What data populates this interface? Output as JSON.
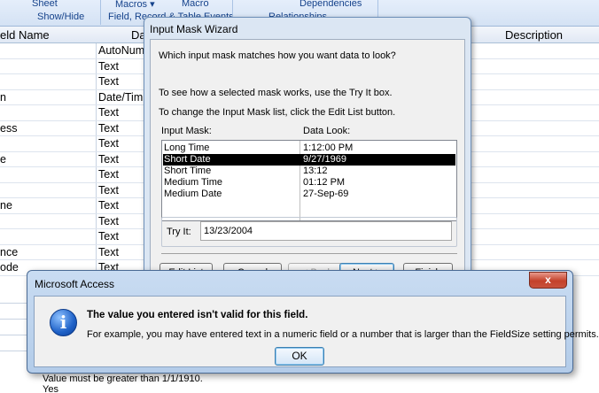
{
  "ribbon": {
    "items": [
      "Sheet",
      "Macros ▾",
      "Macro",
      "Dependencies",
      "Show/Hide",
      "Field, Record & Table Events",
      "Relationships"
    ]
  },
  "grid": {
    "headers": [
      "eld Name",
      "Da",
      "Description"
    ],
    "rows": [
      {
        "name": "",
        "type": "AutoNum"
      },
      {
        "name": "",
        "type": "Text"
      },
      {
        "name": "",
        "type": "Text"
      },
      {
        "name": "n",
        "type": "Date/Tim"
      },
      {
        "name": "",
        "type": "Text"
      },
      {
        "name": "ess",
        "type": "Text"
      },
      {
        "name": "",
        "type": "Text"
      },
      {
        "name": "e",
        "type": "Text"
      },
      {
        "name": "",
        "type": "Text"
      },
      {
        "name": "",
        "type": "Text"
      },
      {
        "name": "ne",
        "type": "Text"
      },
      {
        "name": "",
        "type": "Text"
      },
      {
        "name": "",
        "type": "Text"
      },
      {
        "name": "nce",
        "type": "Text"
      },
      {
        "name": "ode",
        "type": "Text"
      }
    ]
  },
  "lower": {
    "validation_text": "Value must be greater than 1/1/1910.",
    "required": "Yes"
  },
  "wizard": {
    "title": "Input Mask Wizard",
    "question": "Which input mask matches how you want data to look?",
    "try_hint": "To see how a selected mask works, use the Try It box.",
    "edit_hint": "To change the Input Mask list, click the Edit List button.",
    "col_mask": "Input Mask:",
    "col_look": "Data Look:",
    "masks": [
      {
        "mask": "Long Time",
        "look": "1:12:00 PM"
      },
      {
        "mask": "Short Date",
        "look": "9/27/1969"
      },
      {
        "mask": "Short Time",
        "look": "13:12"
      },
      {
        "mask": "Medium Time",
        "look": "01:12 PM"
      },
      {
        "mask": "Medium Date",
        "look": "27-Sep-69"
      }
    ],
    "selected_index": 1,
    "try_label": "Try It:",
    "try_value": "13/23/2004",
    "buttons": {
      "edit_list": "Edit List",
      "cancel": "Cancel",
      "back": "< Back",
      "next": "Next >",
      "finish": "Finish"
    }
  },
  "dialog": {
    "title": "Microsoft Access",
    "close": "x",
    "icon": "information-icon",
    "heading": "The value you entered isn't valid for this field.",
    "body": "For example, you may have entered text in a numeric field or a number that is larger than the FieldSize setting permits.",
    "ok": "OK"
  }
}
